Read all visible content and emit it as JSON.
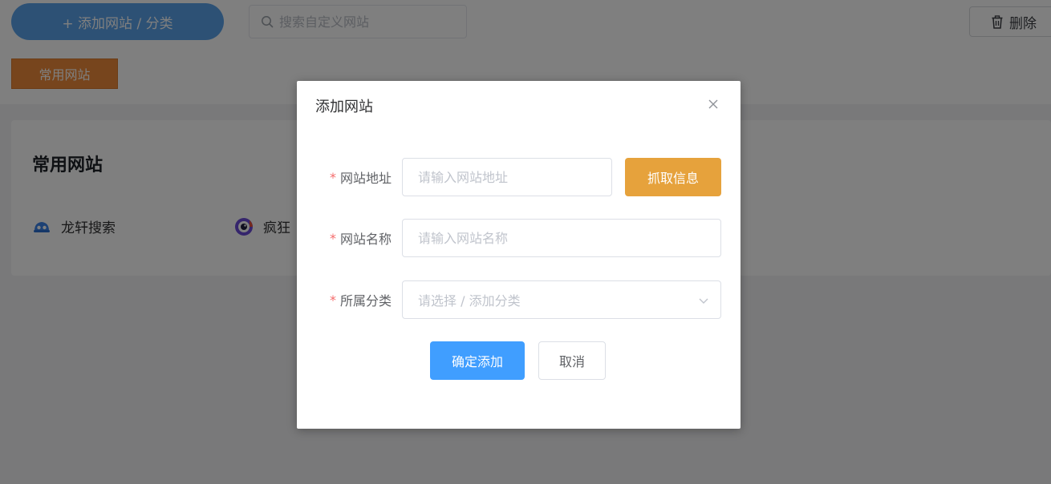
{
  "toolbar": {
    "add_label": "+ 添加网站 / 分类",
    "search_placeholder": "搜索自定义网站",
    "delete_label": "删除"
  },
  "category_tag": {
    "label": "常用网站"
  },
  "section": {
    "title": "常用网站",
    "sites": [
      {
        "label": "龙轩搜索",
        "icon": "blue-robot-icon"
      },
      {
        "label": "疯狂",
        "icon": "purple-eye-icon"
      }
    ]
  },
  "dialog": {
    "title": "添加网站",
    "url_label": "网站地址",
    "url_placeholder": "请输入网站地址",
    "fetch_label": "抓取信息",
    "name_label": "网站名称",
    "name_placeholder": "请输入网站名称",
    "category_label": "所属分类",
    "category_placeholder": "请选择 / 添加分类",
    "required_mark": "*",
    "confirm_label": "确定添加",
    "cancel_label": "取消"
  },
  "colors": {
    "primary": "#409eff",
    "warning": "#e6a23c",
    "tag_orange": "#ee8a3a",
    "required_red": "#f56c6c"
  }
}
